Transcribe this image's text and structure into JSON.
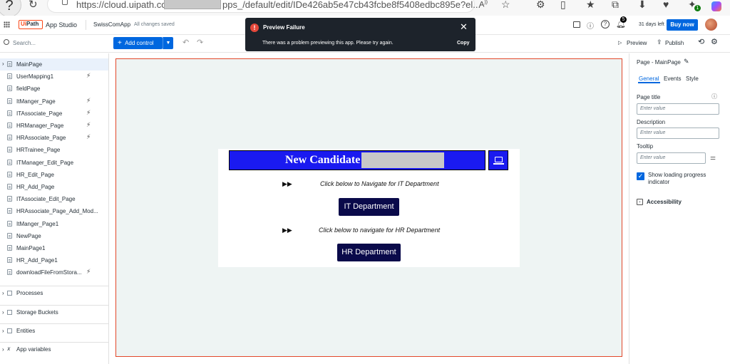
{
  "browser": {
    "url_prefix": "https://cloud.uipath.com",
    "url_suffix": "pps_/default/edit/IDe426ab5e47cb43fcbe8f5408edbc895e?el...",
    "badges": {
      "download_count": "1"
    }
  },
  "app": {
    "product": "App Studio",
    "app_name": "SwissComApp",
    "save_status": "All changes saved",
    "notification_count": "5",
    "trial": "31 days left",
    "buy_label": "Buy now"
  },
  "toolbar": {
    "search_placeholder": "Search...",
    "add_control_label": "Add control",
    "preview_label": "Preview",
    "publish_label": "Publish"
  },
  "sidebar": {
    "pages": [
      {
        "label": "MainPage",
        "selected": true,
        "trigger": false
      },
      {
        "label": "UserMapping1",
        "trigger": true
      },
      {
        "label": "fieldPage",
        "trigger": false
      },
      {
        "label": "ItManger_Page",
        "trigger": true
      },
      {
        "label": "ITAssociate_Page",
        "trigger": true
      },
      {
        "label": "HRManager_Page",
        "trigger": true
      },
      {
        "label": "HRAssociate_Page",
        "trigger": true
      },
      {
        "label": "HRTrainee_Page",
        "trigger": false
      },
      {
        "label": "ITManager_Edit_Page",
        "trigger": false
      },
      {
        "label": "HR_Edit_Page",
        "trigger": false
      },
      {
        "label": "HR_Add_Page",
        "trigger": false
      },
      {
        "label": "ITAssociate_Edit_Page",
        "trigger": false
      },
      {
        "label": "HRAssociate_Page_Add_Mod...",
        "trigger": false
      },
      {
        "label": "ItManger_Page1",
        "trigger": false
      },
      {
        "label": "NewPage",
        "trigger": false
      },
      {
        "label": "MainPage1",
        "trigger": false
      },
      {
        "label": "HR_Add_Page1",
        "trigger": false
      },
      {
        "label": "downloadFileFromStora...",
        "trigger": true
      }
    ],
    "sections": [
      "Processes",
      "Storage Buckets",
      "Entities",
      "App variables"
    ]
  },
  "canvas": {
    "banner_title": "New Candidate",
    "it_prompt": "Click below to Navigate for IT Department",
    "it_button": "IT Department",
    "hr_prompt": "Click below to navigate for HR Department",
    "hr_button": "HR Department"
  },
  "properties": {
    "header": "Page - MainPage",
    "tabs": [
      "General",
      "Events",
      "Style"
    ],
    "page_title_label": "Page title",
    "description_label": "Description",
    "tooltip_label": "Tooltip",
    "placeholder": "Enter value",
    "loading_indicator_label_1": "Show loading progress",
    "loading_indicator_label_2": "indicator",
    "loading_indicator_checked": true,
    "accessibility_label": "Accessibility"
  },
  "toast": {
    "title": "Preview Failure",
    "message": "There was a problem previewing this app. Please try again.",
    "copy_label": "Copy"
  },
  "colors": {
    "accent": "#0067df",
    "brand": "#fa4616",
    "banner": "#1a1af0",
    "dept_button": "#0a0a4a",
    "canvas_border": "#e2472a",
    "toast_bg": "#1d232b",
    "error": "#e4473a"
  }
}
